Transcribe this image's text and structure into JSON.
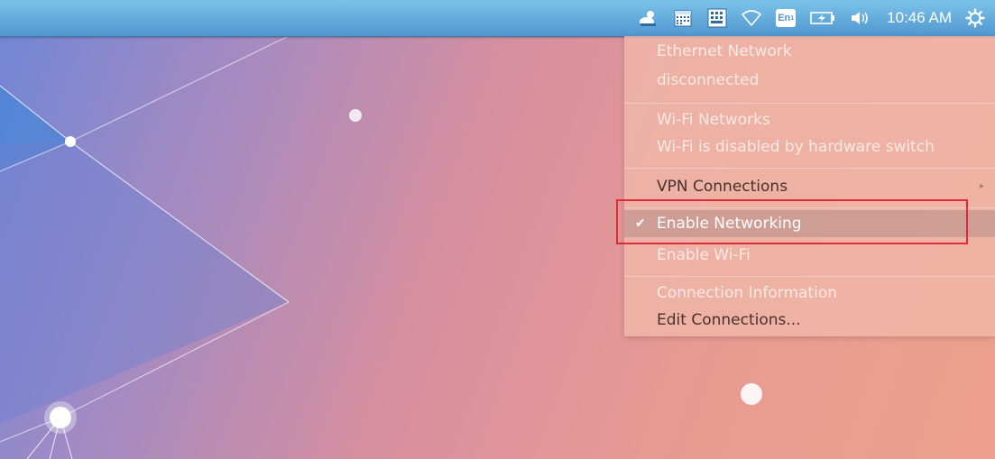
{
  "panel": {
    "clock": "10:46 AM",
    "icons": [
      "weather-icon",
      "calendar-icon",
      "keyboard-layout-icon",
      "network-wifi-icon",
      "language-indicator-icon",
      "battery-icon",
      "volume-icon",
      "settings-gear-icon"
    ],
    "language": "En",
    "language_sub": "1"
  },
  "network_menu": {
    "ethernet_header": "Ethernet Network",
    "ethernet_status": "disconnected",
    "wifi_header": "Wi-Fi Networks",
    "wifi_status": "Wi-Fi is disabled by hardware switch",
    "vpn": "VPN Connections",
    "vpn_arrow": "▸",
    "enable_networking": "Enable Networking",
    "enable_networking_checked": true,
    "check_mark": "✔",
    "enable_wifi": "Enable Wi-Fi",
    "connection_info": "Connection Information",
    "edit_connections": "Edit Connections..."
  },
  "colors": {
    "panel_top": "#7cc3ea",
    "panel_bottom": "#4f97d0",
    "menu_bg": "#f0b8aa",
    "annotation_red": "#e0293a"
  }
}
